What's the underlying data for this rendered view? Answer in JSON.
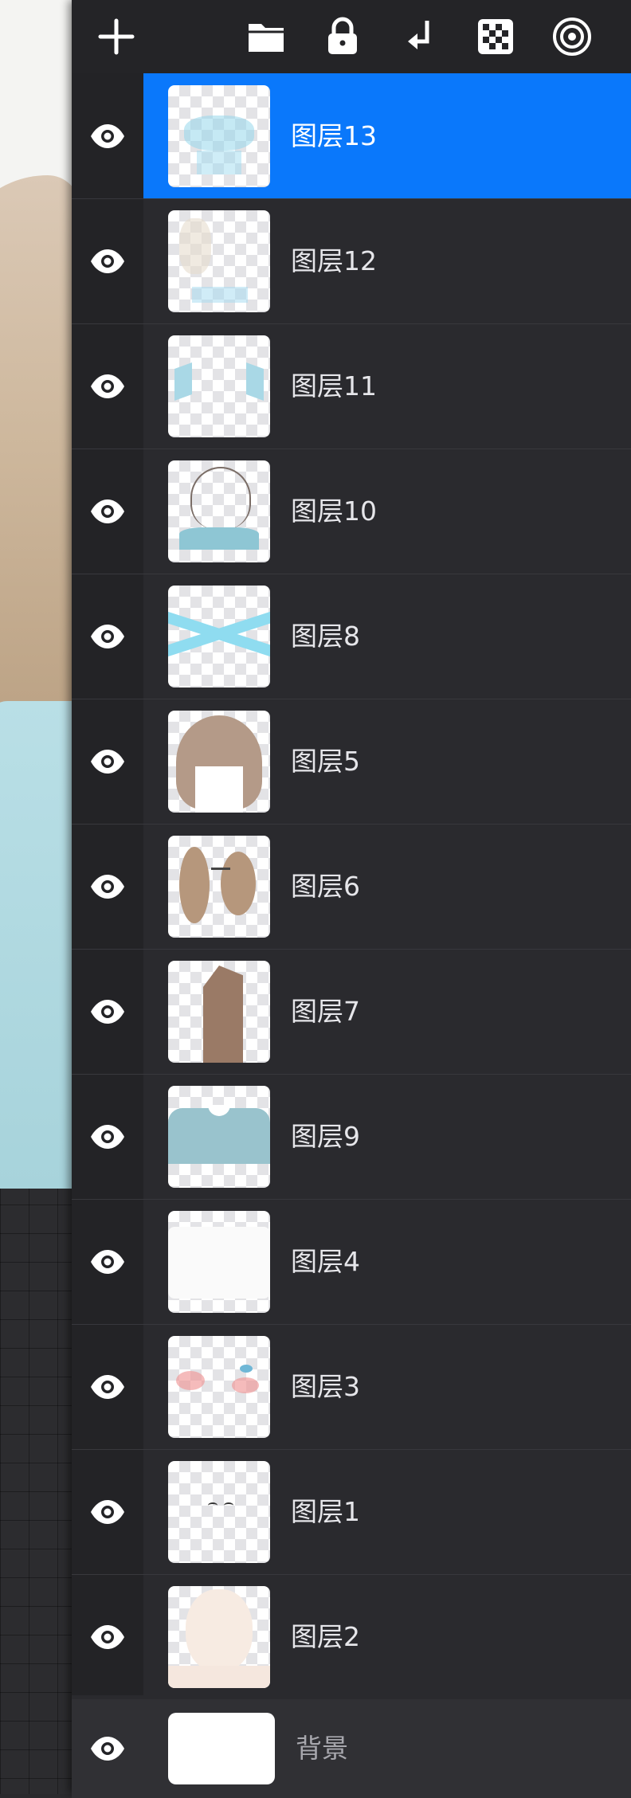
{
  "toolbar": {
    "buttons": [
      {
        "name": "add-layer-button",
        "icon": "plus-icon"
      },
      {
        "name": "layer-group-button",
        "icon": "folder-icon"
      },
      {
        "name": "lock-layer-button",
        "icon": "lock-icon"
      },
      {
        "name": "merge-down-button",
        "icon": "arrow-down-left-icon"
      },
      {
        "name": "checkerboard-button",
        "icon": "checkerboard-icon"
      },
      {
        "name": "layer-target-button",
        "icon": "target-icon"
      }
    ]
  },
  "layers": [
    {
      "name": "图层13",
      "visible": true,
      "selected": true,
      "thumb": "light-blue-ribbon"
    },
    {
      "name": "图层12",
      "visible": true,
      "selected": false,
      "thumb": "hair-highlights"
    },
    {
      "name": "图层11",
      "visible": true,
      "selected": false,
      "thumb": "collar-tips"
    },
    {
      "name": "图层10",
      "visible": true,
      "selected": false,
      "thumb": "outline-sketch"
    },
    {
      "name": "图层8",
      "visible": true,
      "selected": false,
      "thumb": "blue-x-ribbon"
    },
    {
      "name": "图层5",
      "visible": true,
      "selected": false,
      "thumb": "brown-hair"
    },
    {
      "name": "图层6",
      "visible": true,
      "selected": false,
      "thumb": "brown-curls"
    },
    {
      "name": "图层7",
      "visible": true,
      "selected": false,
      "thumb": "brown-strip"
    },
    {
      "name": "图层9",
      "visible": true,
      "selected": false,
      "thumb": "blue-shirt"
    },
    {
      "name": "图层4",
      "visible": true,
      "selected": false,
      "thumb": "white-shape"
    },
    {
      "name": "图层3",
      "visible": true,
      "selected": false,
      "thumb": "blush-eyes"
    },
    {
      "name": "图层1",
      "visible": true,
      "selected": false,
      "thumb": "face-lines"
    },
    {
      "name": "图层2",
      "visible": true,
      "selected": false,
      "thumb": "skin-base"
    }
  ],
  "background_layer": {
    "name": "背景",
    "visible": true
  },
  "colors": {
    "accent": "#0a78fb",
    "panel": "#2a2a2e",
    "text": "#e6e6ea",
    "muted": "#a8a8ae"
  }
}
